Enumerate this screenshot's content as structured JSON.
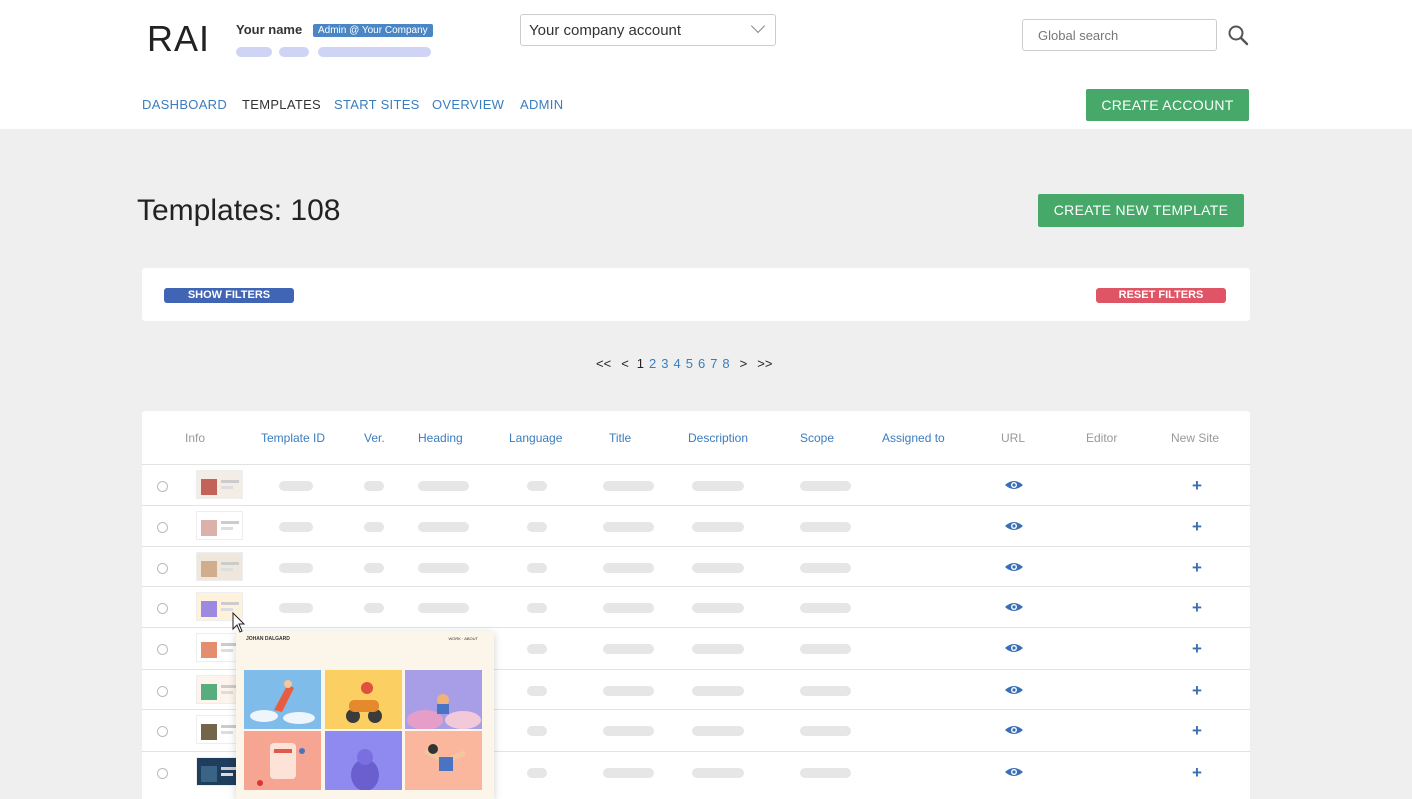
{
  "app": {
    "logo": "RAI"
  },
  "user": {
    "name": "Your name",
    "role_badge": "Admin @ Your Company"
  },
  "account_select": {
    "value": "Your company account"
  },
  "search": {
    "placeholder": "Global search"
  },
  "nav": {
    "items": [
      {
        "label": "DASHBOARD",
        "active": false
      },
      {
        "label": "TEMPLATES",
        "active": true
      },
      {
        "label": "START SITES",
        "active": false
      },
      {
        "label": "OVERVIEW",
        "active": false
      },
      {
        "label": "ADMIN",
        "active": false
      }
    ],
    "create_account_label": "CREATE ACCOUNT"
  },
  "page": {
    "title": "Templates: 108",
    "create_template_label": "CREATE NEW TEMPLATE"
  },
  "filters": {
    "show_label": "SHOW FILTERS",
    "reset_label": "RESET FILTERS"
  },
  "pagination": {
    "first": "<<",
    "prev": "<",
    "pages": [
      "1",
      "2",
      "3",
      "4",
      "5",
      "6",
      "7",
      "8"
    ],
    "current": "1",
    "next": ">",
    "last": ">>"
  },
  "table": {
    "columns": [
      "Info",
      "Template ID",
      "Ver.",
      "Heading",
      "Language",
      "Title",
      "Description",
      "Scope",
      "Assigned to",
      "URL",
      "Editor",
      "New Site"
    ],
    "row_count": 8
  },
  "preview_popup": {
    "heading": "JOHAN DALGARD",
    "menu": "WORK · ABOUT"
  },
  "colors": {
    "accent_blue": "#3a7dbf",
    "green": "#46a96a",
    "filter_blue": "#4065b4",
    "reset_red": "#e05565",
    "badge_blue": "#4a86c5"
  },
  "icons": {
    "search": "search-icon",
    "dropdown": "chevron-down-icon",
    "url": "eye-icon",
    "new_site": "plus-icon"
  }
}
